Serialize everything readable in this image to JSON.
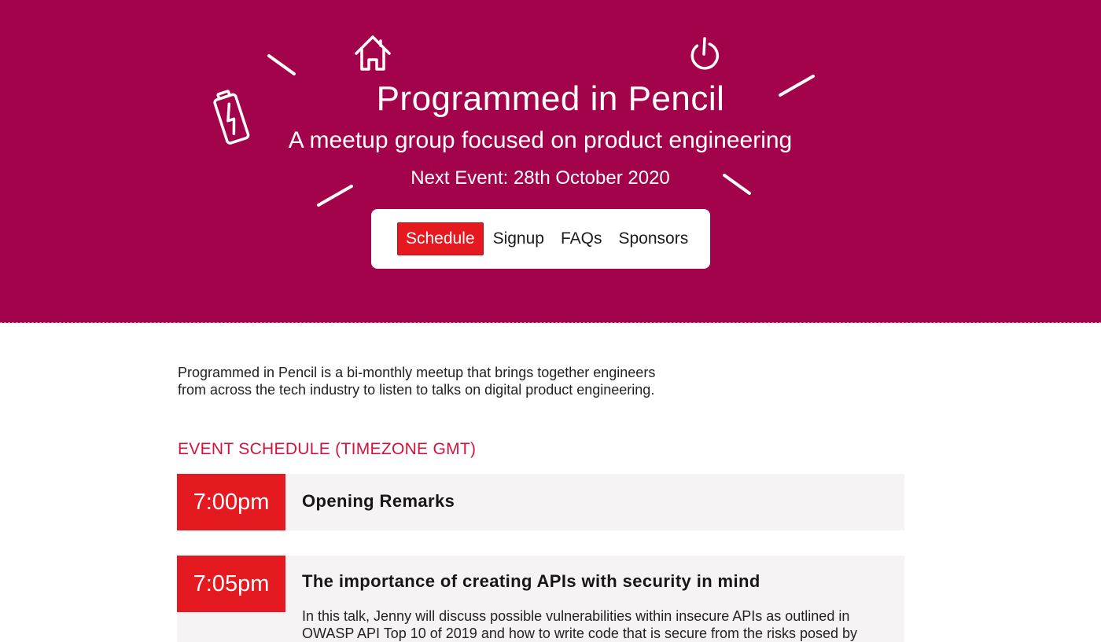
{
  "hero": {
    "title": "Programmed in Pencil",
    "subtitle": "A meetup group focused on product engineering",
    "next_event": "Next Event: 28th October 2020",
    "icons": [
      "house-icon",
      "power-icon",
      "battery-icon"
    ],
    "background_color": "#a3034a"
  },
  "nav": {
    "items": [
      {
        "label": "Schedule",
        "active": true
      },
      {
        "label": "Signup",
        "active": false
      },
      {
        "label": "FAQs",
        "active": false
      },
      {
        "label": "Sponsors",
        "active": false
      }
    ],
    "active_color": "#e51a21"
  },
  "intro": {
    "text": "Programmed in Pencil is a bi-monthly meetup that brings together engineers from across the tech industry to listen to talks on digital product engineering."
  },
  "schedule": {
    "heading": "EVENT SCHEDULE (TIMEZONE GMT)",
    "heading_color": "#d1133d",
    "slots": [
      {
        "time": "7:00pm",
        "title": "Opening Remarks",
        "description": ""
      },
      {
        "time": "7:05pm",
        "title": "The importance of creating APIs with security in mind",
        "description": "In this talk, Jenny will discuss possible vulnerabilities within insecure APIs as outlined in OWASP API Top 10 of 2019 and how to write code that is secure from the risks posed by"
      }
    ]
  }
}
